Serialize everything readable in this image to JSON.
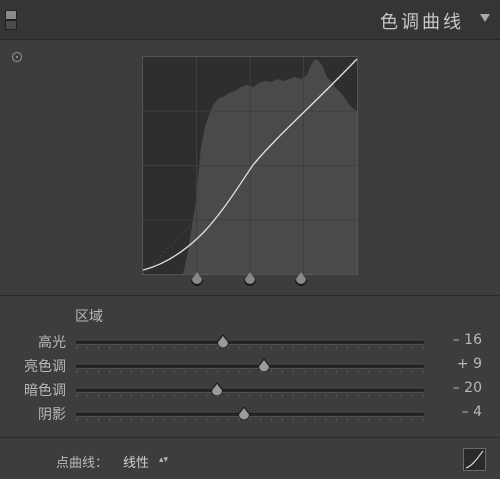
{
  "header": {
    "title": "色调曲线",
    "collapse_icon": "triangle-down-icon"
  },
  "curve": {
    "target_icon": "target-adjust-icon",
    "region_handle_positions": [
      0.25,
      0.5,
      0.75
    ]
  },
  "regions": {
    "label": "区域",
    "sliders": [
      {
        "label": "高光",
        "value": "– 16",
        "position": 0.423
      },
      {
        "label": "亮色调",
        "value": "+ 9",
        "position": 0.54
      },
      {
        "label": "暗色调",
        "value": "– 20",
        "position": 0.405
      },
      {
        "label": "阴影",
        "value": "– 4",
        "position": 0.482
      }
    ]
  },
  "footer": {
    "point_curve_label": "点曲线：",
    "point_curve_value": "线性",
    "point_curve_button_icon": "curve-edit-icon"
  },
  "colors": {
    "panel_bg": "#3d3d3d",
    "curve_bg": "#2e2e2e",
    "histogram": "#4a4a4a",
    "curve_line": "#e0e0e0"
  }
}
